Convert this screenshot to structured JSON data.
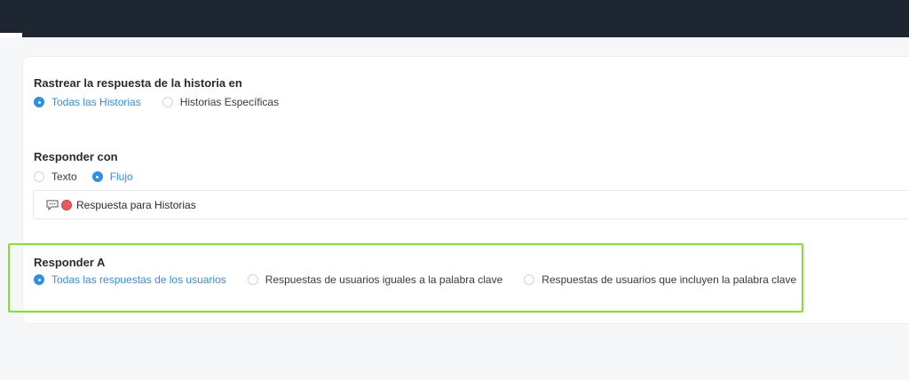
{
  "section1": {
    "title": "Rastrear la respuesta de la historia en",
    "options": [
      {
        "label": "Todas las Historias",
        "checked": true
      },
      {
        "label": "Historias Específicas",
        "checked": false
      }
    ]
  },
  "section2": {
    "title": "Responder con",
    "options": [
      {
        "label": "Texto",
        "checked": false
      },
      {
        "label": "Flujo",
        "checked": true
      }
    ],
    "flow": {
      "name": "Respuesta para Historias",
      "icon": "chat-icon",
      "badge_color": "#e85a63"
    }
  },
  "section3": {
    "title": "Responder A",
    "options": [
      {
        "label": "Todas las respuestas de los usuarios",
        "checked": true
      },
      {
        "label": "Respuestas de usuarios iguales a la palabra clave",
        "checked": false
      },
      {
        "label": "Respuestas de usuarios que incluyen la palabra clave",
        "checked": false
      }
    ]
  },
  "colors": {
    "accent": "#2f8fe8",
    "topbar": "#1e2632",
    "highlight": "#7fe52a"
  }
}
